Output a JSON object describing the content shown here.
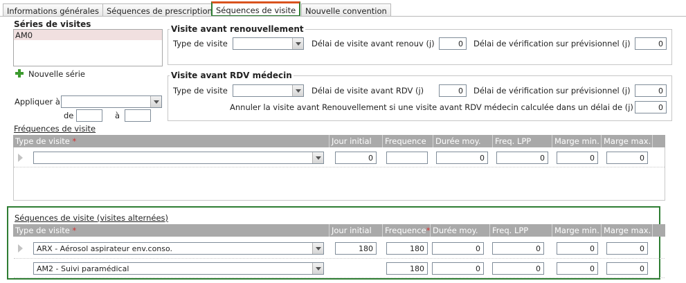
{
  "tabs": [
    {
      "label": "Informations générales"
    },
    {
      "label": "Séquences de prescription"
    },
    {
      "label": "Séquences de visite"
    },
    {
      "label": "Nouvelle convention"
    }
  ],
  "series": {
    "title": "Séries de visites",
    "items": [
      "AM0"
    ],
    "new_label": "Nouvelle série",
    "apply_label": "Appliquer à",
    "de_label": "de",
    "a_label": "à",
    "apply_value": "",
    "de_value": "",
    "a_value": ""
  },
  "renouvellement": {
    "legend": "Visite avant renouvellement",
    "type_label": "Type de visite",
    "type_value": "",
    "delai_label": "Délai de visite avant renouv (j)",
    "delai_value": "0",
    "verif_label": "Délai de vérification sur prévisionnel (j)",
    "verif_value": "0"
  },
  "rdv": {
    "legend": "Visite avant RDV médecin",
    "type_label": "Type de visite",
    "type_value": "",
    "delai_label": "Délai de visite avant RDV (j)",
    "delai_value": "0",
    "verif_label": "Délai de vérification sur prévisionnel (j)",
    "verif_value": "0",
    "annuler_label": "Annuler la visite avant Renouvellement si une visite avant RDV médecin calculée dans un délai de (j)",
    "annuler_value": "0"
  },
  "frequences": {
    "title": "Fréquences de visite",
    "columns": [
      "Type de visite",
      "Jour initial",
      "Frequence",
      "Durée moy.",
      "Freq. LPP",
      "Marge min.",
      "Marge max."
    ],
    "rows": [
      {
        "type": "",
        "jour": "0",
        "freq": "",
        "duree": "0",
        "lpp": "0",
        "min": "0",
        "max": "0"
      }
    ]
  },
  "sequences": {
    "title": "Séquences de visite (visites alternées)",
    "columns": [
      "Type de visite",
      "Jour initial",
      "Frequence",
      "Durée moy.",
      "Freq. LPP",
      "Marge min.",
      "Marge max."
    ],
    "rows": [
      {
        "type": "ARX - Aérosol aspirateur env.conso.",
        "jour": "180",
        "freq": "180",
        "duree": "0",
        "lpp": "0",
        "min": "0",
        "max": "0"
      },
      {
        "type": "AM2 - Suivi paramédical",
        "jour": "",
        "freq": "180",
        "duree": "0",
        "lpp": "0",
        "min": "0",
        "max": "0"
      }
    ]
  },
  "colors": {
    "accent_green": "#2e7d32",
    "active_tab_top": "#d9531e",
    "header_gray": "#a9a9a9",
    "selected_row": "#f1e0e0",
    "required": "#d32f2f"
  }
}
